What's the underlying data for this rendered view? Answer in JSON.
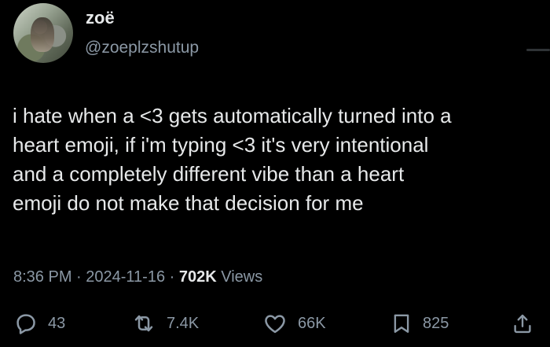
{
  "user": {
    "display_name": "zoë",
    "handle": "@zoeplzshutup"
  },
  "tweet": {
    "text": "i hate when a <3 gets automatically turned into a\nheart emoji, if i'm typing <3 it's very intentional\nand a completely different vibe than a heart\nemoji do not make that decision for me",
    "time": "8:36 PM",
    "separator": " · ",
    "date": "2024-11-16",
    "views_count": "702K",
    "views_label": " Views"
  },
  "actions": {
    "replies": "43",
    "reposts": "7.4K",
    "likes": "66K",
    "bookmarks": "825"
  },
  "icons": {
    "reply": "reply-icon",
    "repost": "repost-icon",
    "like": "heart-icon",
    "bookmark": "bookmark-icon",
    "share": "share-icon"
  },
  "colors": {
    "background": "#000000",
    "primary_text": "#e7e9ea",
    "secondary_text": "#8b98a5"
  }
}
